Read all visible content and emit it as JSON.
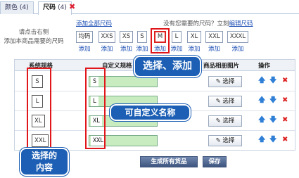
{
  "tabs": [
    {
      "label": "颜色",
      "count": "(4)"
    },
    {
      "label": "尺码",
      "count": "(4)"
    }
  ],
  "hint": {
    "line1": "请点击右侧",
    "line2": "添加本商品需要的尺码"
  },
  "picker": {
    "add_all_link": "添加全部尺码",
    "missing_text": "没有您需要的尺码？立刻",
    "edit_link": "编辑尺码",
    "chips": [
      {
        "label": "均码",
        "add": "添加"
      },
      {
        "label": "XXS",
        "add": "添加"
      },
      {
        "label": "XS",
        "add": "添加"
      },
      {
        "label": "S",
        "add": "添加"
      },
      {
        "label": "M",
        "add": "添加"
      },
      {
        "label": "L",
        "add": "添加"
      },
      {
        "label": "XL",
        "add": "添加"
      },
      {
        "label": "XXL",
        "add": "添加"
      },
      {
        "label": "XXXL",
        "add": "添加"
      }
    ]
  },
  "table": {
    "headers": {
      "system": "系统规格",
      "custom": "自定义规格",
      "image": "商品相册图片",
      "ops": "操作"
    },
    "rows": [
      {
        "system": "S",
        "name": "S",
        "choose": "选择"
      },
      {
        "system": "L",
        "name": "L",
        "choose": "选择"
      },
      {
        "system": "XL",
        "name": "XL",
        "choose": "选择"
      },
      {
        "system": "XXL",
        "name": "XXL",
        "choose": "选择"
      }
    ]
  },
  "buttons": {
    "generate": "生成所有货品",
    "save": "保存"
  },
  "annotations": {
    "select_add": "选择、添加",
    "custom_name": "可自定义名称",
    "selected_line1": "选择的",
    "selected_line2": "内容"
  },
  "colors": {
    "annotation_red": "#e0161a",
    "callout_blue": "#1c5fb4",
    "field_green": "#c8ecc0",
    "link_blue": "#1a4db3"
  }
}
